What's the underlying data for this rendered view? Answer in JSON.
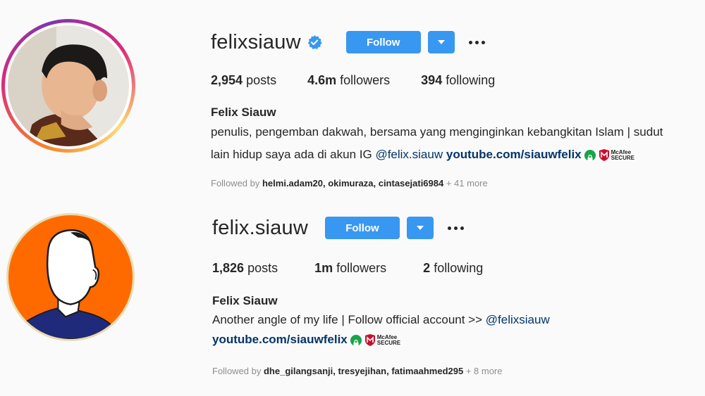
{
  "profiles": [
    {
      "username": "felixsiauw",
      "verified": true,
      "follow_label": "Follow",
      "stats": {
        "posts_value": "2,954",
        "posts_label": "posts",
        "followers_value": "4.6m",
        "followers_label": "followers",
        "following_value": "394",
        "following_label": "following"
      },
      "full_name": "Felix Siauw",
      "bio_line1": "penulis, pengemban dakwah, bersama yang menginginkan kebangkitan Islam | sudut",
      "bio_line2": "lain hidup saya ada di akun IG ",
      "bio_mention": "@felix.siauw",
      "external_link": "youtube.com/siauwfelix",
      "mcafee_line1": "McAfee",
      "mcafee_line2": "SECURE",
      "followed_by_prefix": "Followed by ",
      "followed_by_names": "helmi.adam20, okimuraza, cintasejati6984",
      "followed_by_more": " + 41 more"
    },
    {
      "username": "felix.siauw",
      "verified": false,
      "follow_label": "Follow",
      "stats": {
        "posts_value": "1,826",
        "posts_label": "posts",
        "followers_value": "1m",
        "followers_label": "followers",
        "following_value": "2",
        "following_label": "following"
      },
      "full_name": "Felix Siauw",
      "bio_line1": "Another angle of my life | Follow official account >> ",
      "bio_mention": "@felixsiauw",
      "external_link": "youtube.com/siauwfelix",
      "mcafee_line1": "McAfee",
      "mcafee_line2": "SECURE",
      "followed_by_prefix": "Followed by ",
      "followed_by_names": "dhe_gilangsanji, tresyejihan, fatimaahmed295",
      "followed_by_more": " + 8 more"
    }
  ],
  "colors": {
    "follow_button": "#3897f0",
    "link": "#003569",
    "muted": "#8e8e8e",
    "avatar2_bg": "#ff6a00"
  },
  "icons": [
    "verified-badge-icon",
    "chevron-down-icon",
    "more-options-icon",
    "lock-icon",
    "mcafee-shield-icon"
  ]
}
